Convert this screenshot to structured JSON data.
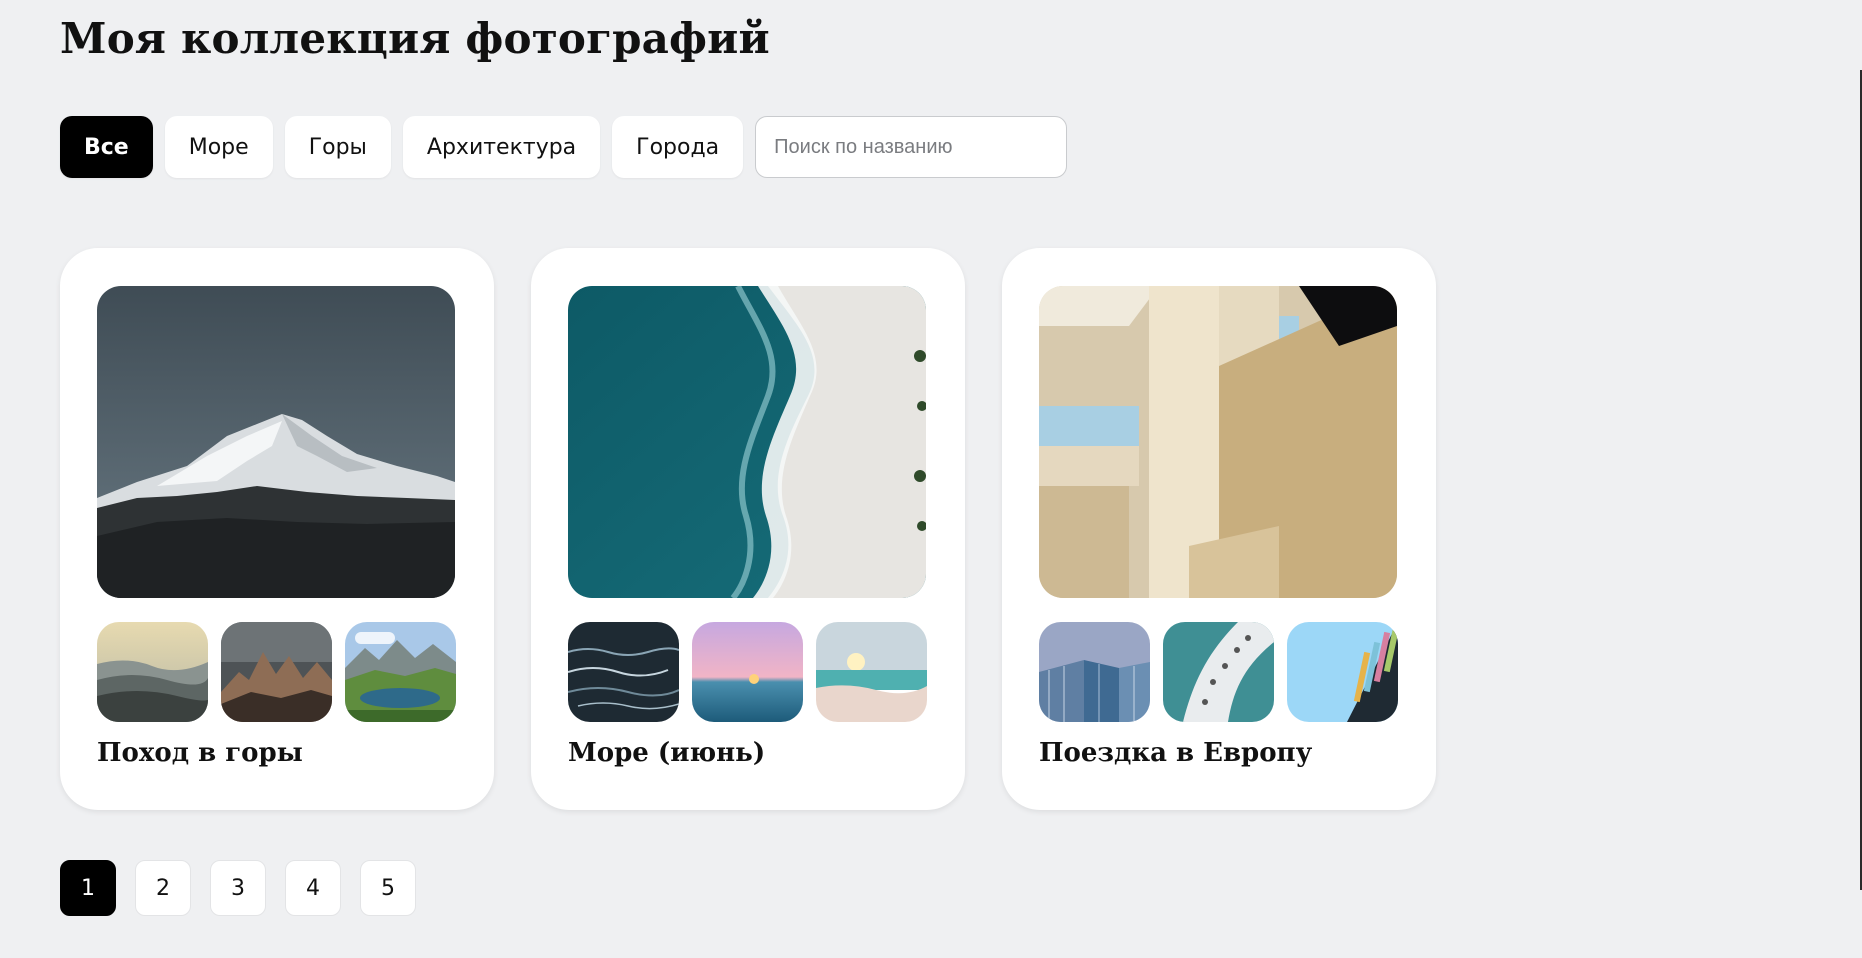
{
  "header": {
    "title": "Моя коллекция фотографий"
  },
  "filters": {
    "chips": [
      {
        "label": "Все",
        "active": true
      },
      {
        "label": "Море",
        "active": false
      },
      {
        "label": "Горы",
        "active": false
      },
      {
        "label": "Архитектура",
        "active": false
      },
      {
        "label": "Города",
        "active": false
      }
    ],
    "search_placeholder": "Поиск по названию"
  },
  "albums": [
    {
      "title": "Поход в горы",
      "main_photo": "snowy-mountain-photo",
      "thumbnails": [
        "misty-hills-photo",
        "rocky-peaks-photo",
        "alpine-lake-photo"
      ]
    },
    {
      "title": "Море (июнь)",
      "main_photo": "aerial-beach-waves-photo",
      "thumbnails": [
        "dark-water-ripples-photo",
        "pink-sunset-sea-photo",
        "sunny-beach-photo"
      ]
    },
    {
      "title": "Поездка в Европу",
      "main_photo": "modern-architecture-photo",
      "thumbnails": [
        "glass-building-photo",
        "curved-tower-photo",
        "colorful-facade-photo"
      ]
    }
  ],
  "pagination": {
    "pages": [
      "1",
      "2",
      "3",
      "4",
      "5"
    ],
    "current": "1"
  },
  "colors": {
    "background": "#eff0f2",
    "accent": "#000000",
    "card": "#ffffff"
  }
}
